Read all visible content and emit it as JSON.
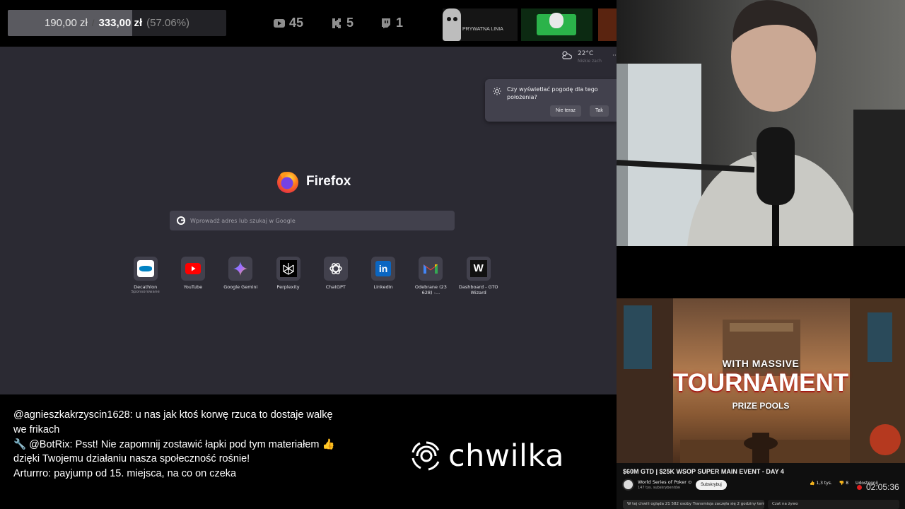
{
  "topbar": {
    "goal": {
      "current": "190,00 zł",
      "separator": "/",
      "target": "333,00 zł",
      "percent_label": "(57.06%)",
      "progress": 0.5706
    },
    "stats": [
      {
        "icon": "youtube-icon",
        "value": "45"
      },
      {
        "icon": "kick-icon",
        "value": "5"
      },
      {
        "icon": "twitch-icon",
        "value": "1"
      }
    ],
    "thumb_label": "PRYWATNA LINIA"
  },
  "browser": {
    "weather": {
      "temp": "22°C",
      "desc": "Niskie zach"
    },
    "popup": {
      "text": "Czy wyświetlać pogodę dla tego położenia?",
      "btn_later": "Nie teraz",
      "btn_yes": "Tak"
    },
    "logo_text": "Firefox",
    "search": {
      "placeholder": "Wprowadź adres lub szukaj w Google"
    },
    "shortcuts": [
      {
        "label": "Decathlon",
        "sub": "Sponsorowane",
        "icon": "decathlon-icon"
      },
      {
        "label": "YouTube",
        "sub": "",
        "icon": "youtube-icon"
      },
      {
        "label": "Google Gemini",
        "sub": "",
        "icon": "gemini-icon"
      },
      {
        "label": "Perplexity",
        "sub": "",
        "icon": "perplexity-icon"
      },
      {
        "label": "ChatGPT",
        "sub": "",
        "icon": "chatgpt-icon"
      },
      {
        "label": "LinkedIn",
        "sub": "",
        "icon": "linkedin-icon"
      },
      {
        "label": "Odebrane (23 628) -...",
        "sub": "",
        "icon": "gmail-icon"
      },
      {
        "label": "Dashboard - GTO Wizard",
        "sub": "",
        "icon": "gto-wizard-icon"
      }
    ]
  },
  "chat": {
    "messages": [
      "@agnieszkakrzyscin1628: u nas jak ktoś korwę rzuca to dostaje walkę we frikach",
      "🔧 @BotRix: Psst! Nie zapomnij zostawić łapki pod tym materiałem 👍 dzięki Twojemu działaniu nasza społeczność rośnie!",
      "Arturrro: payjump od 15. miejsca, na co on czeka"
    ],
    "brand": "chwilka"
  },
  "youtube": {
    "video_text": {
      "line1": "WITH MASSIVE",
      "line2": "TOURNAMENT",
      "line3": "PRIZE POOLS"
    },
    "title": "$60M GTD | $25K WSOP SUPER MAIN EVENT - DAY 4",
    "channel": "World Series of Poker ⊙",
    "subs": "147 tys. subskrybentów",
    "subscribe": "Subskrybuj",
    "likes": "1,3 tys.",
    "dislikes": "8",
    "share": "Udostępnij",
    "time": "02:05:36",
    "info": "W tej chwili ogląda 21 582 osoby  Transmisja zaczęła się 2 godziny temu",
    "chat_label": "Czat na żywo"
  }
}
